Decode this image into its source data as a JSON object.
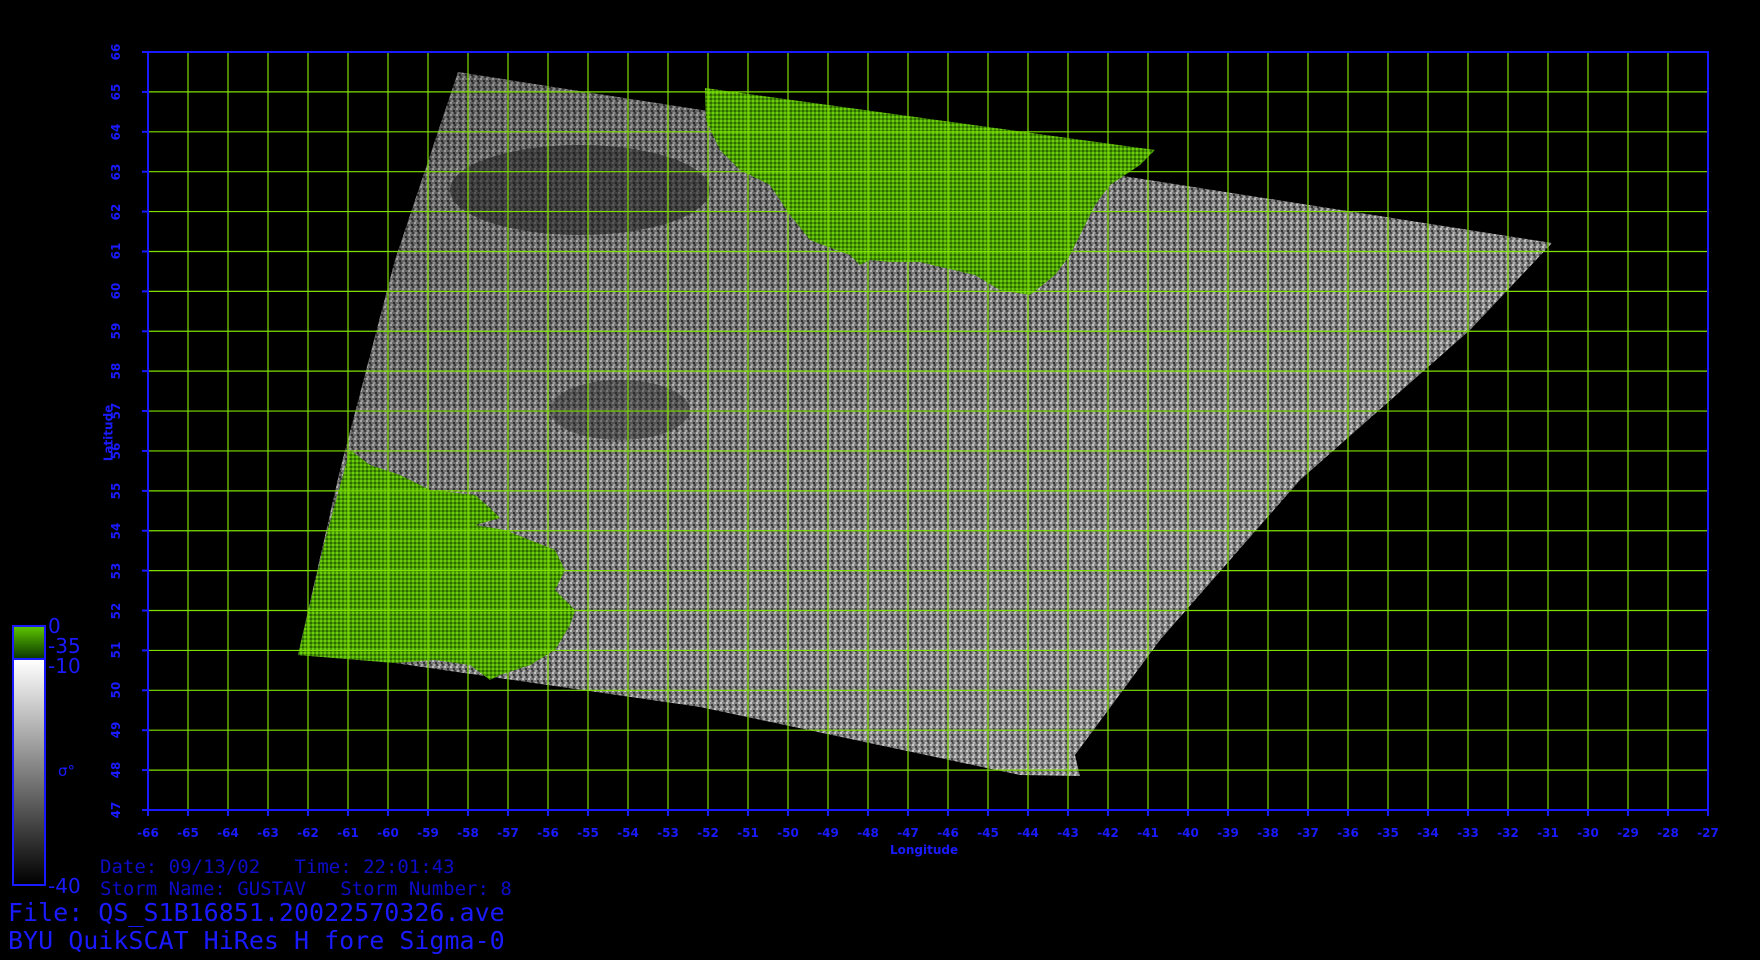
{
  "latitude_ticks": [
    "47",
    "48",
    "49",
    "50",
    "51",
    "52",
    "53",
    "54",
    "55",
    "56",
    "57",
    "58",
    "59",
    "60",
    "61",
    "62",
    "63",
    "64",
    "65",
    "66"
  ],
  "longitude_ticks": [
    "-66",
    "-65",
    "-64",
    "-63",
    "-62",
    "-61",
    "-60",
    "-59",
    "-58",
    "-57",
    "-56",
    "-55",
    "-54",
    "-53",
    "-52",
    "-51",
    "-50",
    "-49",
    "-48",
    "-47",
    "-46",
    "-45",
    "-44",
    "-43",
    "-42",
    "-41",
    "-40",
    "-39",
    "-38",
    "-37",
    "-36",
    "-35",
    "-34",
    "-33",
    "-32",
    "-31",
    "-30",
    "-29",
    "-28",
    "-27"
  ],
  "axis": {
    "x_title": "Longitude",
    "y_title": "Latitude"
  },
  "colorbar": {
    "green_top": "0",
    "green_bottom": "-35",
    "grey_top": "-10",
    "grey_bottom": "-40",
    "symbol": "σ°"
  },
  "info": {
    "date_time": "Date: 09/13/02   Time: 22:01:43",
    "storm": "Storm Name: GUSTAV   Storm Number: 8",
    "file": "File: QS_S1B16851.20022570326.ave",
    "product": "BYU QuikSCAT HiRes H fore Sigma-0"
  },
  "colors": {
    "grid": "#7fe000",
    "axis_text": "#1a1aff",
    "land": "#4fa800",
    "frame": "#1a1aff"
  }
}
